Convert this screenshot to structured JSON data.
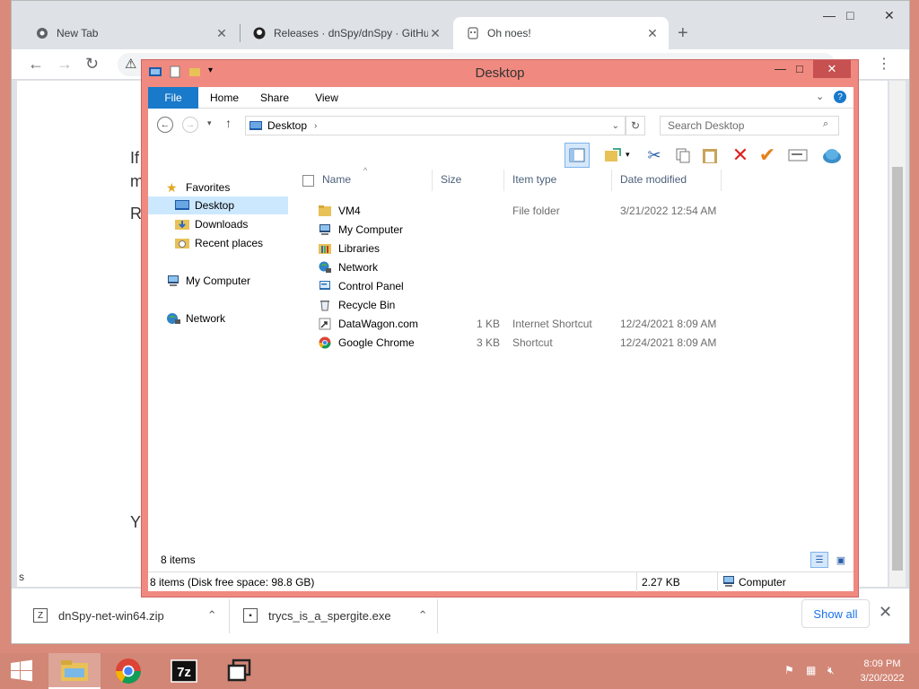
{
  "browser": {
    "tabs": [
      {
        "label": "New Tab"
      },
      {
        "label": "Releases · dnSpy/dnSpy · GitHub"
      },
      {
        "label": "Oh noes!"
      }
    ],
    "page_fragments": [
      "If",
      "m",
      "R",
      "Y",
      "s"
    ],
    "downloads": [
      {
        "name": "dnSpy-net-win64.zip"
      },
      {
        "name": "trycs_is_a_spergite.exe"
      }
    ],
    "show_all_label": "Show all"
  },
  "explorer": {
    "title": "Desktop",
    "ribbon_tabs": [
      "File",
      "Home",
      "Share",
      "View"
    ],
    "address": "Desktop",
    "search_placeholder": "Search Desktop",
    "nav": {
      "favorites": "Favorites",
      "desktop": "Desktop",
      "downloads": "Downloads",
      "recent": "Recent places",
      "my_computer": "My Computer",
      "network": "Network"
    },
    "columns": {
      "name": "Name",
      "size": "Size",
      "type": "Item type",
      "date": "Date modified"
    },
    "files": [
      {
        "name": "VM4",
        "size": "",
        "type": "File folder",
        "date": "3/21/2022 12:54 AM",
        "icon": "folder-icon"
      },
      {
        "name": "My Computer",
        "size": "",
        "type": "",
        "date": "",
        "icon": "computer-icon"
      },
      {
        "name": "Libraries",
        "size": "",
        "type": "",
        "date": "",
        "icon": "libraries-icon"
      },
      {
        "name": "Network",
        "size": "",
        "type": "",
        "date": "",
        "icon": "network-icon"
      },
      {
        "name": "Control Panel",
        "size": "",
        "type": "",
        "date": "",
        "icon": "control-panel-icon"
      },
      {
        "name": "Recycle Bin",
        "size": "",
        "type": "",
        "date": "",
        "icon": "recycle-bin-icon"
      },
      {
        "name": "DataWagon.com",
        "size": "1 KB",
        "type": "Internet Shortcut",
        "date": "12/24/2021 8:09 AM",
        "icon": "internet-shortcut-icon"
      },
      {
        "name": "Google Chrome",
        "size": "3 KB",
        "type": "Shortcut",
        "date": "12/24/2021 8:09 AM",
        "icon": "chrome-icon"
      }
    ],
    "item_count": "8 items",
    "status_items": "8 items (Disk free space: 98.8 GB)",
    "status_size": "2.27 KB",
    "status_location": "Computer"
  },
  "taskbar": {
    "time": "8:09 PM",
    "date": "3/20/2022"
  },
  "colors": {
    "desktop": "#d98a7a",
    "explorer_frame": "#f08a80",
    "file_tab": "#1979ca",
    "selection": "#cce8ff"
  }
}
